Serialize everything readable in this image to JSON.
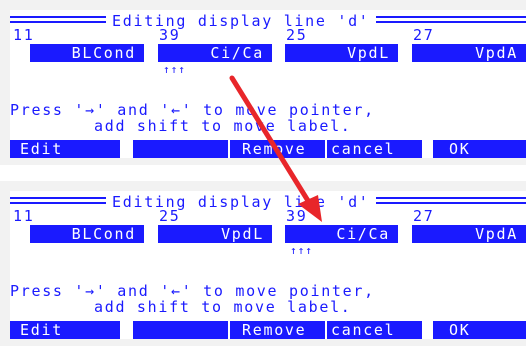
{
  "panels": [
    {
      "title": "Editing display line 'd'",
      "columns": [
        {
          "number": "11",
          "label": "BLCond"
        },
        {
          "number": "39",
          "label": "Ci/Ca"
        },
        {
          "number": "25",
          "label": "VpdL"
        },
        {
          "number": "27",
          "label": "VpdA"
        }
      ],
      "pointer": "↑↑↑",
      "messages": [
        "Press '→' and '←' to move pointer,",
        "add shift to move label."
      ],
      "function_keys": [
        "Edit",
        "",
        "Remove",
        "cancel",
        "OK"
      ]
    },
    {
      "title": "Editing display line 'd'",
      "columns": [
        {
          "number": "11",
          "label": "BLCond"
        },
        {
          "number": "25",
          "label": "VpdL"
        },
        {
          "number": "39",
          "label": "Ci/Ca"
        },
        {
          "number": "27",
          "label": "VpdA"
        }
      ],
      "pointer": "↑↑↑",
      "messages": [
        "Press '→' and '←' to move pointer,",
        "add shift to move label."
      ],
      "function_keys": [
        "Edit",
        "",
        "Remove",
        "cancel",
        "OK"
      ]
    }
  ],
  "colors": {
    "screen_text": "#1a1aff",
    "highlight_bg": "#1a1aff",
    "annotation_arrow": "#e8262a"
  }
}
